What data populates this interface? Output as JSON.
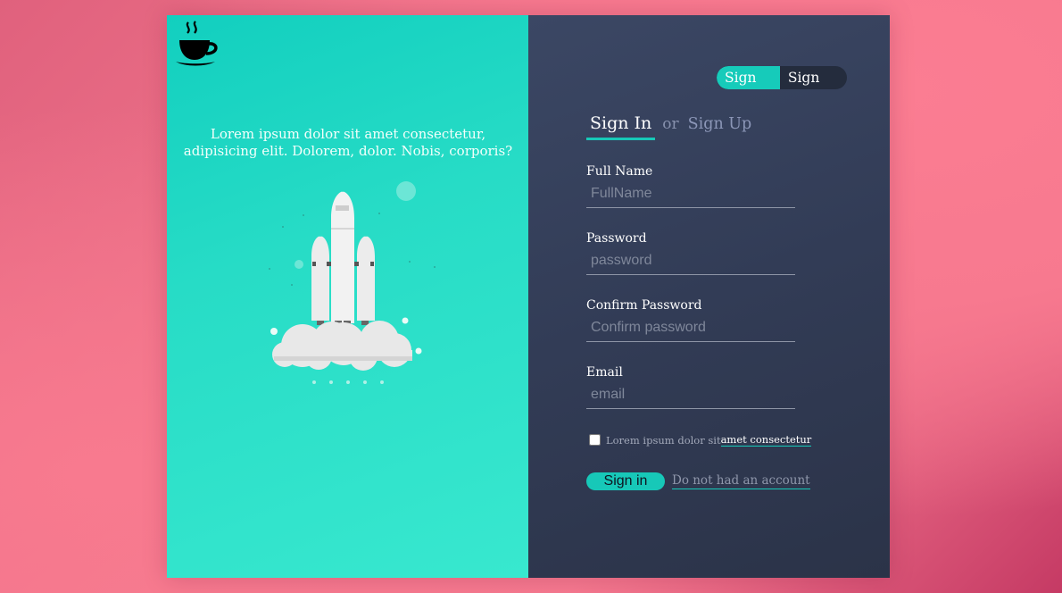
{
  "hero": {
    "tagline": "Lorem ipsum dolor sit amet consectetur, adipisicing elit. Dolorem, dolor. Nobis, corporis?"
  },
  "switcher": {
    "sign_in": "Sign In",
    "sign_up": "Sign Up"
  },
  "form_title": {
    "active": "Sign In",
    "or": "or",
    "inactive": "Sign Up"
  },
  "fields": [
    {
      "label": "Full Name",
      "placeholder": "FullName"
    },
    {
      "label": "Password",
      "placeholder": "password"
    },
    {
      "label": "Confirm Password",
      "placeholder": "Confirm password"
    },
    {
      "label": "Email",
      "placeholder": "email"
    }
  ],
  "agree": {
    "text": "Lorem ipsum dolor sit",
    "link": "amet consectetur"
  },
  "actions": {
    "submit": "Sign in",
    "no_account": "Do not had an account"
  },
  "colors": {
    "accent": "#17c8b8",
    "panel_dark": "#323c56",
    "background": "#f47a8f"
  },
  "icons": {
    "logo": "coffee-cup-icon",
    "illustration": "rocket-launch"
  }
}
